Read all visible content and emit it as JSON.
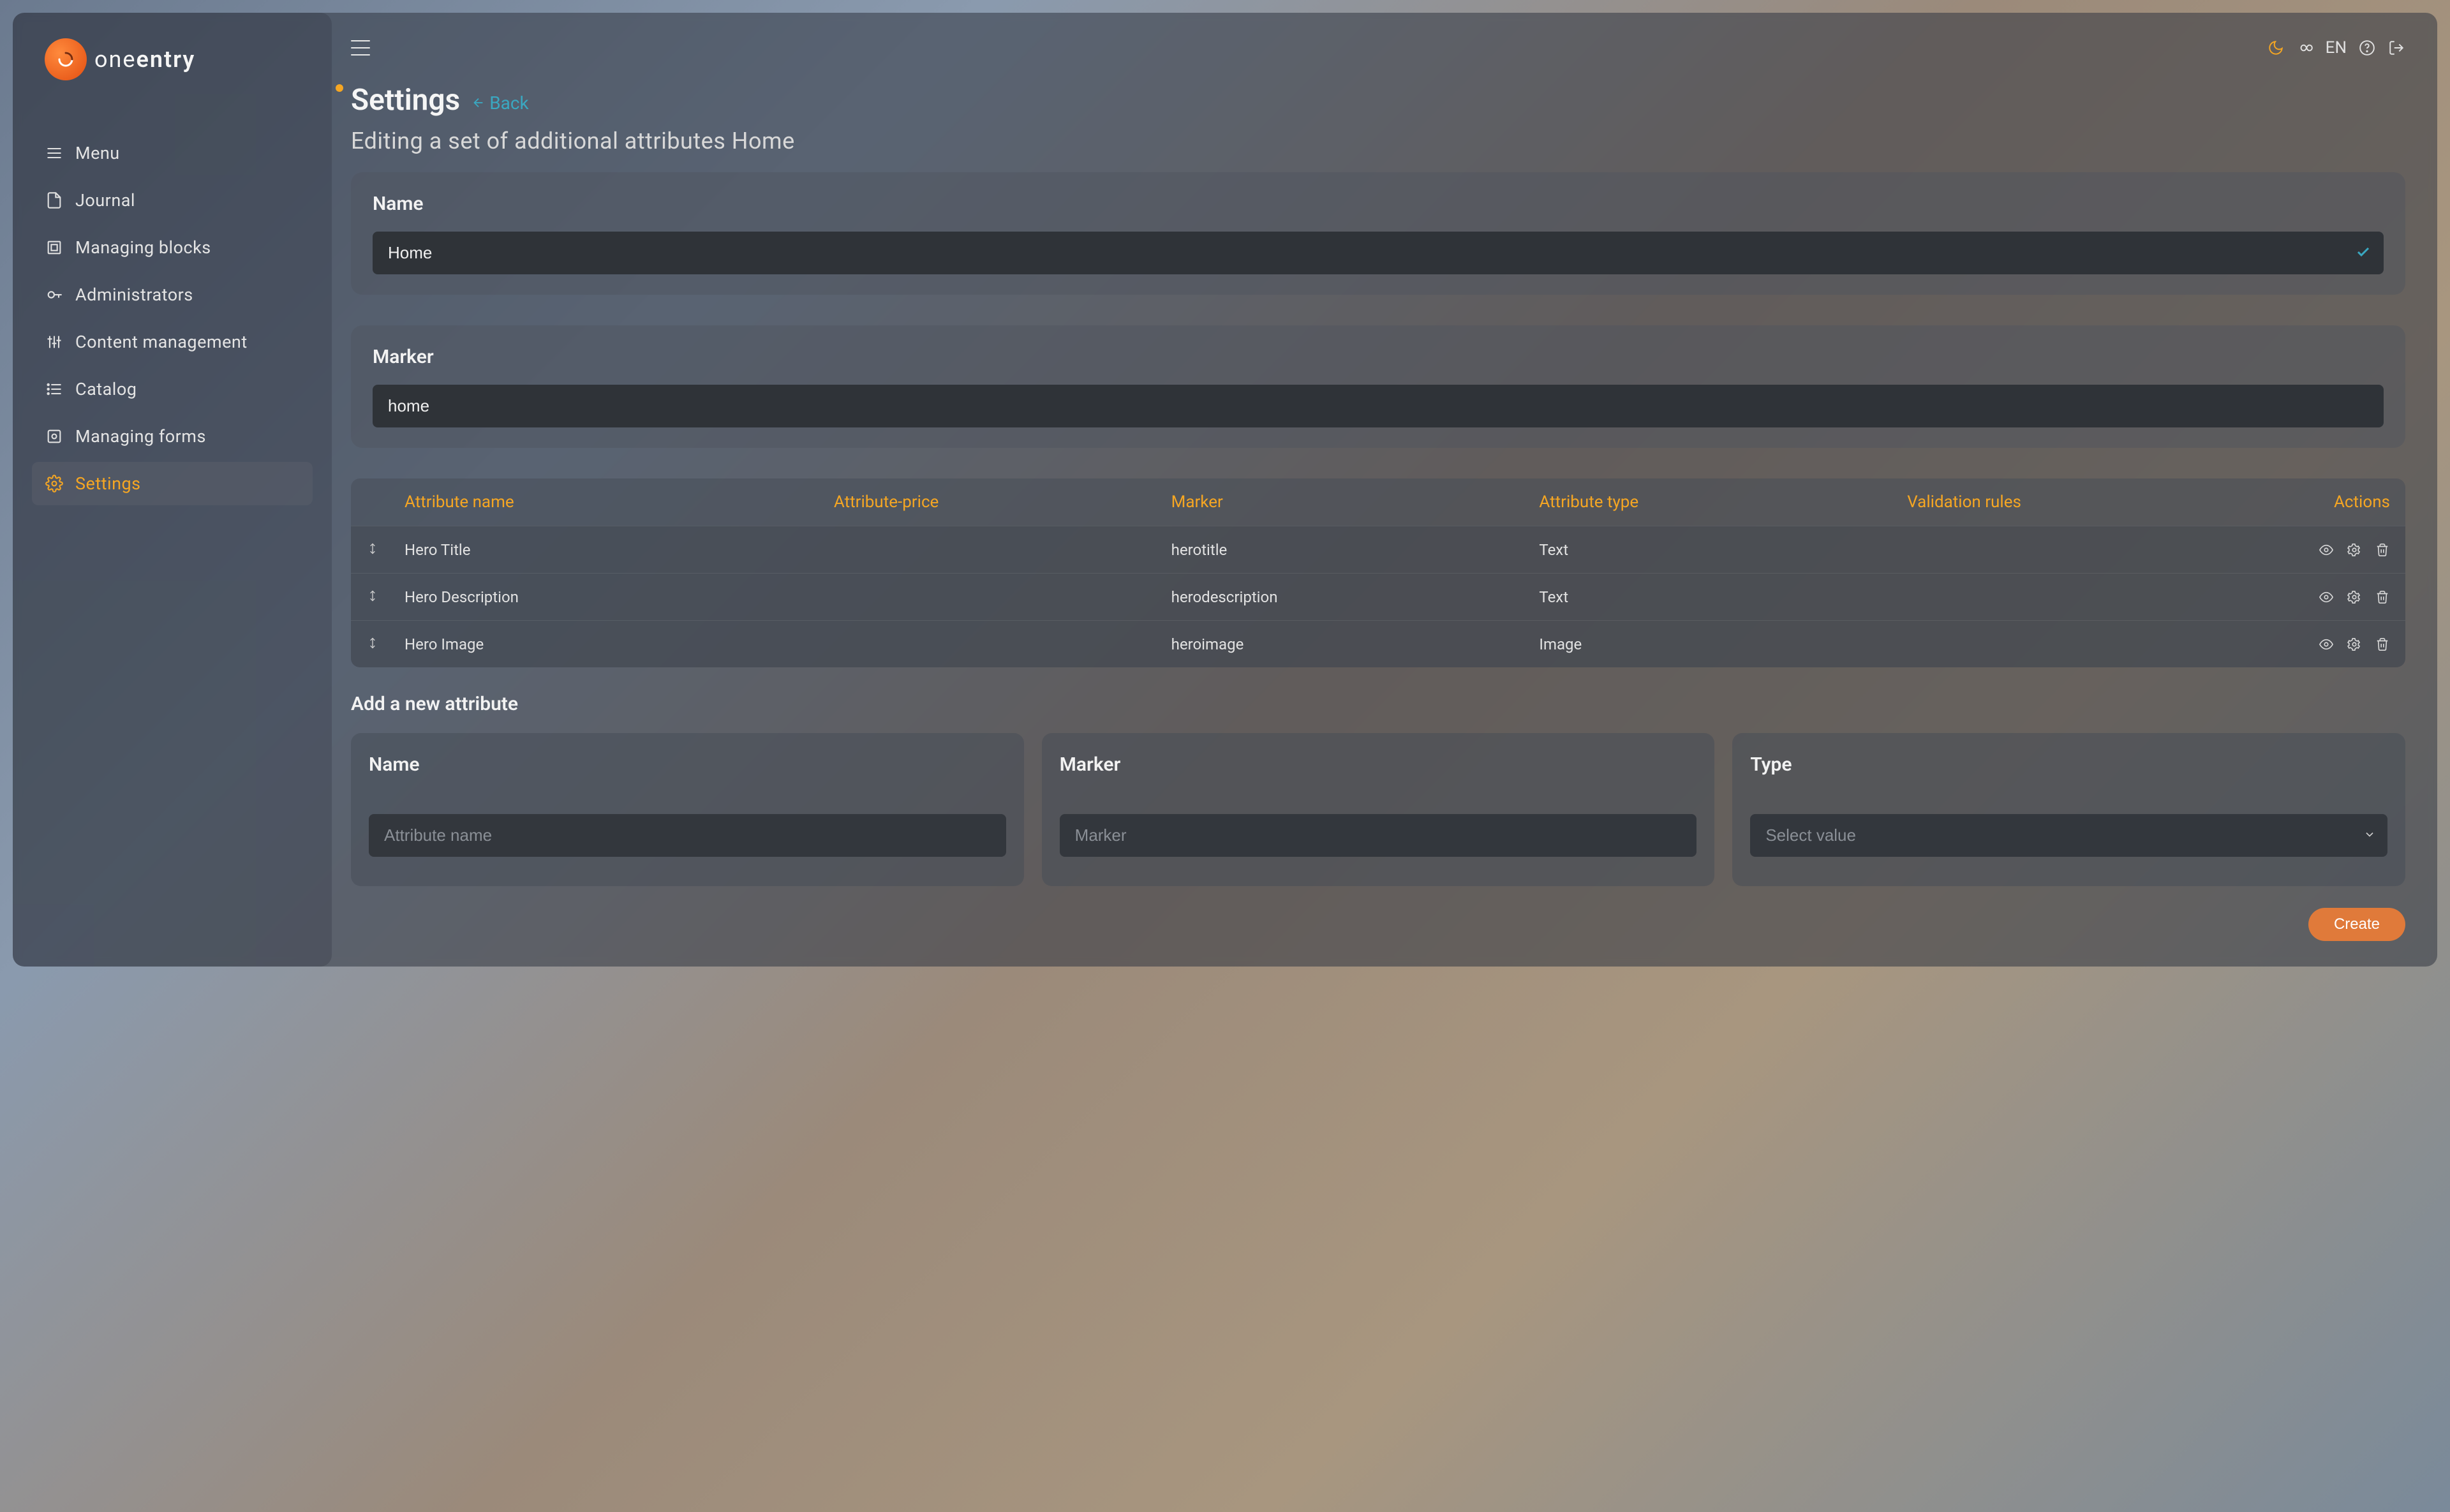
{
  "brand": {
    "part1": "one",
    "part2": "entry"
  },
  "sidebar": {
    "items": [
      {
        "label": "Menu",
        "icon": "menu"
      },
      {
        "label": "Journal",
        "icon": "journal"
      },
      {
        "label": "Managing blocks",
        "icon": "blocks"
      },
      {
        "label": "Administrators",
        "icon": "admins"
      },
      {
        "label": "Content management",
        "icon": "content"
      },
      {
        "label": "Catalog",
        "icon": "catalog"
      },
      {
        "label": "Managing forms",
        "icon": "forms"
      },
      {
        "label": "Settings",
        "icon": "settings",
        "active": true
      }
    ]
  },
  "topbar": {
    "lang": "EN"
  },
  "header": {
    "title": "Settings",
    "back": "Back",
    "subtitle": "Editing a set of additional attributes Home"
  },
  "form": {
    "name_label": "Name",
    "name_value": "Home",
    "marker_label": "Marker",
    "marker_value": "home"
  },
  "table": {
    "columns": {
      "name": "Attribute name",
      "price": "Attribute-price",
      "marker": "Marker",
      "type": "Attribute type",
      "validation": "Validation rules",
      "actions": "Actions"
    },
    "rows": [
      {
        "name": "Hero Title",
        "price": "",
        "marker": "herotitle",
        "type": "Text",
        "validation": ""
      },
      {
        "name": "Hero Description",
        "price": "",
        "marker": "herodescription",
        "type": "Text",
        "validation": ""
      },
      {
        "name": "Hero Image",
        "price": "",
        "marker": "heroimage",
        "type": "Image",
        "validation": ""
      }
    ]
  },
  "add": {
    "section_title": "Add a new attribute",
    "name_label": "Name",
    "name_placeholder": "Attribute name",
    "marker_label": "Marker",
    "marker_placeholder": "Marker",
    "type_label": "Type",
    "type_placeholder": "Select value",
    "create_label": "Create"
  }
}
